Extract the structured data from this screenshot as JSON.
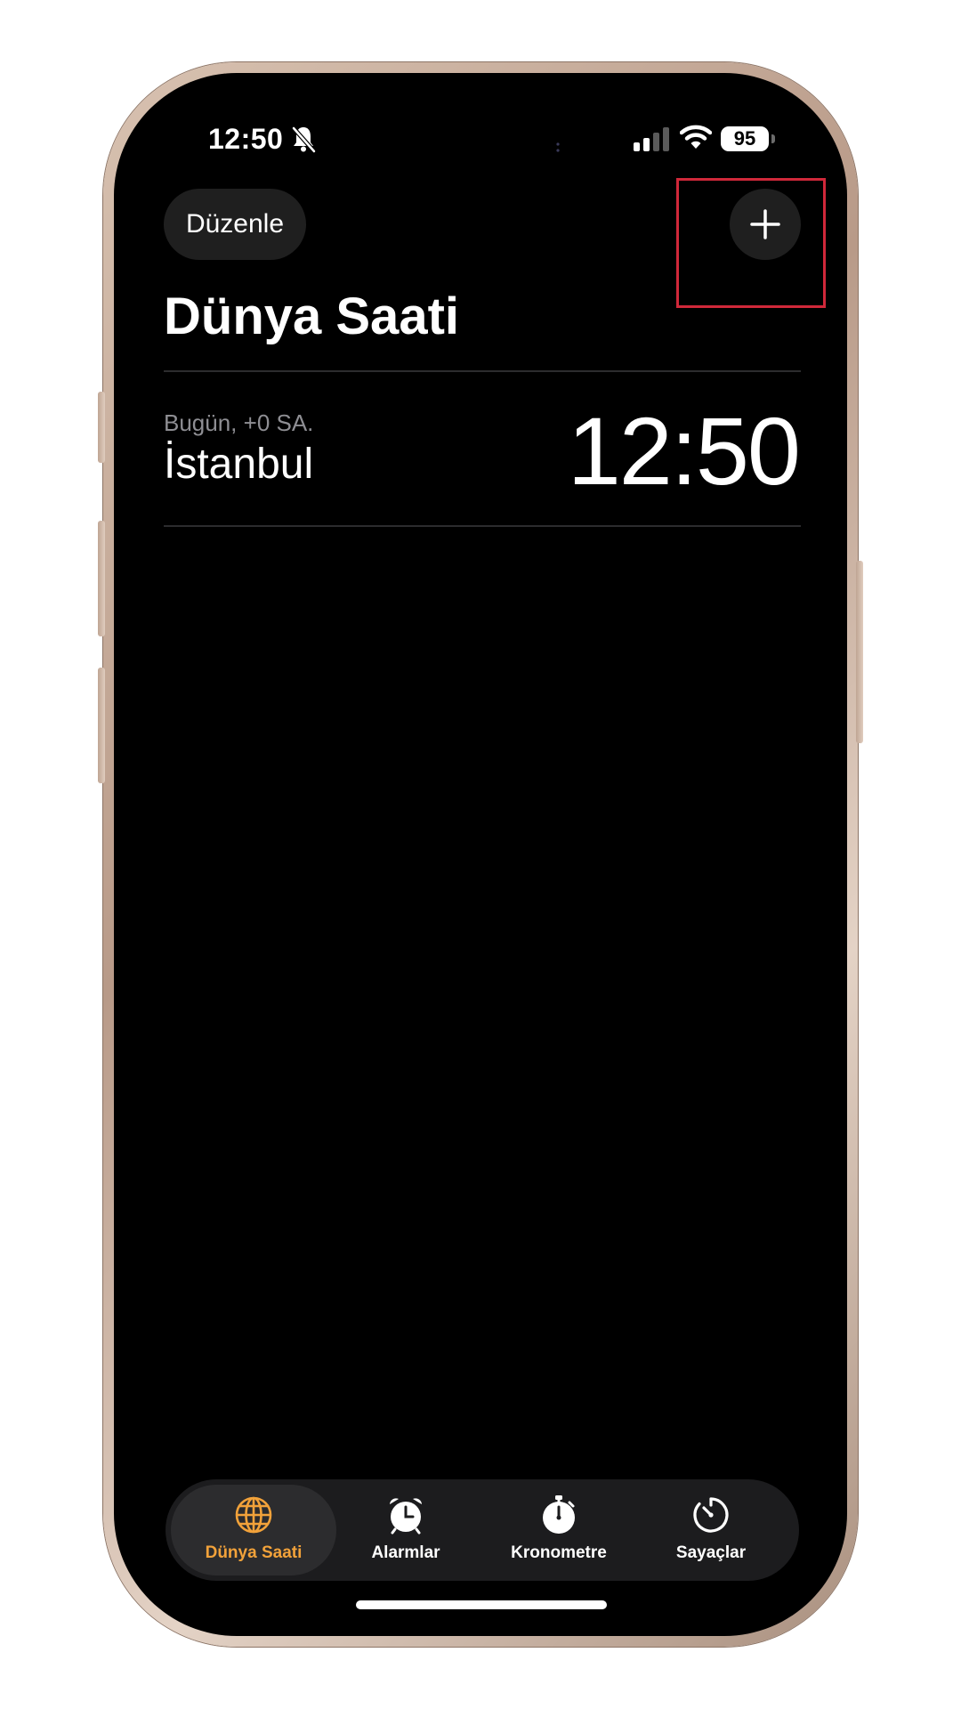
{
  "status_bar": {
    "time": "12:50",
    "battery": "95",
    "icons": [
      "bell-slash-icon",
      "signal-icon",
      "wifi-icon",
      "battery-icon"
    ]
  },
  "header": {
    "edit_label": "Düzenle",
    "add_icon": "plus-icon",
    "title": "Dünya Saati"
  },
  "clocks": [
    {
      "subtitle": "Bugün, +0 SA.",
      "city": "İstanbul",
      "time": "12:50"
    }
  ],
  "tab_bar": {
    "active_index": 0,
    "accent_color": "#f2a23a",
    "tabs": [
      {
        "label": "Dünya Saati",
        "icon": "globe-icon"
      },
      {
        "label": "Alarmlar",
        "icon": "alarm-clock-icon"
      },
      {
        "label": "Kronometre",
        "icon": "stopwatch-icon"
      },
      {
        "label": "Sayaçlar",
        "icon": "timer-icon"
      }
    ]
  },
  "highlight_color": "#d0283a"
}
